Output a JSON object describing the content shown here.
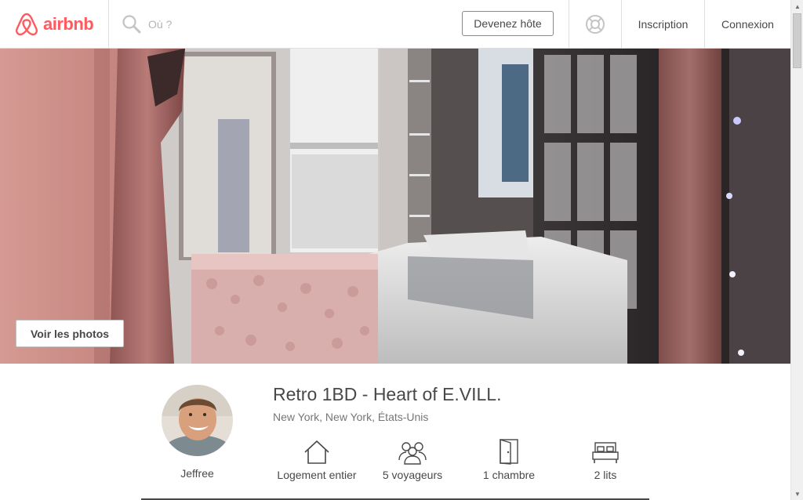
{
  "header": {
    "brand": "airbnb",
    "search_placeholder": "Où ?",
    "host_button": "Devenez hôte",
    "signup": "Inscription",
    "login": "Connexion"
  },
  "hero": {
    "photos_button": "Voir les photos"
  },
  "listing": {
    "title": "Retro 1BD - Heart of E.VILL.",
    "location": "New York, New York, États-Unis",
    "host_name": "Jeffree",
    "features": [
      {
        "icon": "home-icon",
        "label": "Logement entier"
      },
      {
        "icon": "guests-icon",
        "label": "5 voyageurs"
      },
      {
        "icon": "door-icon",
        "label": "1 chambre"
      },
      {
        "icon": "bed-icon",
        "label": "2 lits"
      }
    ]
  },
  "colors": {
    "brand": "#ff5a5f",
    "text": "#484848",
    "muted": "#767676",
    "border": "#dce0e0"
  }
}
